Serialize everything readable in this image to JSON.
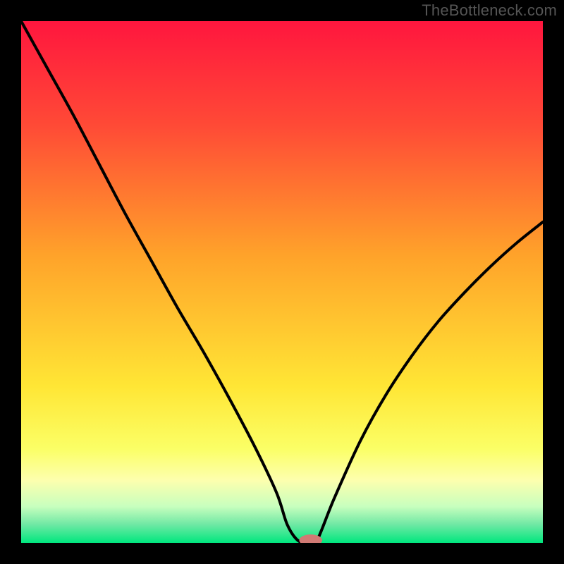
{
  "watermark": "TheBottleneck.com",
  "chart_data": {
    "type": "line",
    "title": "",
    "xlabel": "",
    "ylabel": "",
    "xlim": [
      0,
      100
    ],
    "ylim": [
      0,
      100
    ],
    "gradient_stops": [
      {
        "offset": 0,
        "color": "#ff163e"
      },
      {
        "offset": 0.2,
        "color": "#ff4a36"
      },
      {
        "offset": 0.45,
        "color": "#ffa32a"
      },
      {
        "offset": 0.7,
        "color": "#ffe635"
      },
      {
        "offset": 0.82,
        "color": "#fbff66"
      },
      {
        "offset": 0.88,
        "color": "#fdffae"
      },
      {
        "offset": 0.93,
        "color": "#c8ffbe"
      },
      {
        "offset": 0.965,
        "color": "#6fe8a4"
      },
      {
        "offset": 1.0,
        "color": "#00e77e"
      }
    ],
    "series": [
      {
        "name": "curve",
        "x": [
          0,
          5,
          10,
          15,
          20,
          25,
          30,
          35,
          40,
          45,
          49,
          51,
          53,
          55,
          56.5,
          60,
          65,
          70,
          75,
          80,
          85,
          90,
          95,
          100
        ],
        "values": [
          100,
          91,
          82,
          72.5,
          63,
          54,
          45,
          36.5,
          27.5,
          18,
          9.5,
          3.5,
          0.5,
          0,
          0,
          8.5,
          19.5,
          28.5,
          36,
          42.5,
          48,
          53,
          57.5,
          61.5
        ]
      }
    ],
    "marker": {
      "x": 55.5,
      "y": 0.5,
      "rx": 2.2,
      "ry": 1.1,
      "color": "#d17a74"
    }
  }
}
